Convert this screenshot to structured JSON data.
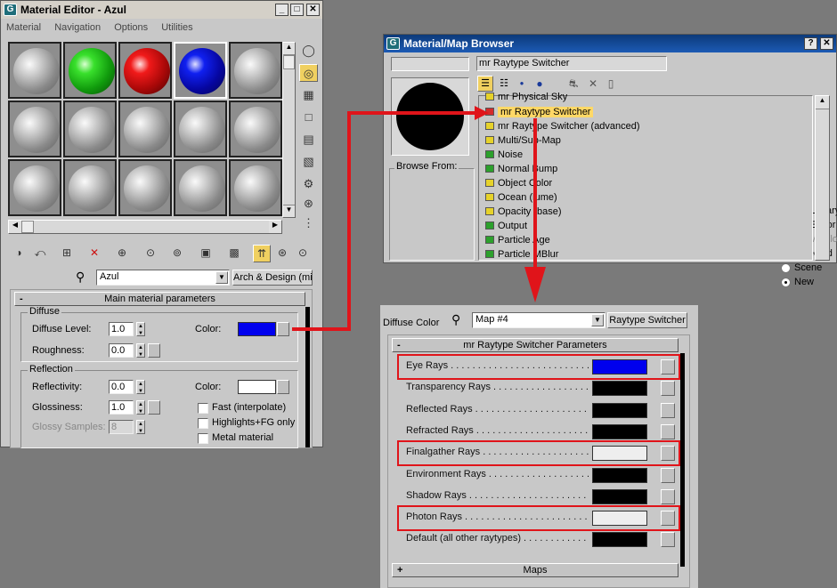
{
  "material_editor": {
    "title": "Material Editor - Azul",
    "menu": [
      "Material",
      "Navigation",
      "Options",
      "Utilities"
    ],
    "material_name": "Azul",
    "material_type": "Arch & Design (mi)",
    "rollout_title": "Main material parameters",
    "diffuse": {
      "group_label": "Diffuse",
      "level_label": "Diffuse Level:",
      "level_value": "1.0",
      "roughness_label": "Roughness:",
      "roughness_value": "0.0",
      "color_label": "Color:",
      "color": "#0000ee"
    },
    "reflection": {
      "group_label": "Reflection",
      "reflectivity_label": "Reflectivity:",
      "reflectivity_value": "0.0",
      "glossiness_label": "Glossiness:",
      "glossiness_value": "1.0",
      "glossy_samples_label": "Glossy Samples:",
      "glossy_samples_value": "8",
      "color_label": "Color:",
      "color": "#ffffff",
      "fast_label": "Fast (interpolate)",
      "highlights_label": "Highlights+FG only",
      "metal_label": "Metal material"
    }
  },
  "browser": {
    "title": "Material/Map Browser",
    "search_value": "mr Raytype Switcher",
    "browse_from_label": "Browse From:",
    "browse_options": [
      {
        "label": "Mtl Library",
        "enabled": true,
        "selected": false
      },
      {
        "label": "Mtl Editor",
        "enabled": true,
        "selected": false
      },
      {
        "label": "Active Slot",
        "enabled": false,
        "selected": false
      },
      {
        "label": "Selected",
        "enabled": true,
        "selected": false
      },
      {
        "label": "Scene",
        "enabled": true,
        "selected": false
      },
      {
        "label": "New",
        "enabled": true,
        "selected": true
      }
    ],
    "list_items": [
      {
        "label": "mr Physical Sky",
        "icon": "yellow"
      },
      {
        "label": "mr Raytype Switcher",
        "icon": "red",
        "highlighted": true
      },
      {
        "label": "mr Raytype Switcher (advanced)",
        "icon": "yellow"
      },
      {
        "label": "Multi/Sub-Map",
        "icon": "yellow"
      },
      {
        "label": "Noise",
        "icon": "green"
      },
      {
        "label": "Normal Bump",
        "icon": "green"
      },
      {
        "label": "Object Color",
        "icon": "yellow"
      },
      {
        "label": "Ocean (lume)",
        "icon": "yellow"
      },
      {
        "label": "Opacity (base)",
        "icon": "yellow"
      },
      {
        "label": "Output",
        "icon": "green"
      },
      {
        "label": "Particle Age",
        "icon": "green"
      },
      {
        "label": "Particle MBlur",
        "icon": "green"
      }
    ]
  },
  "map_panel": {
    "diffuse_color_label": "Diffuse Color",
    "map_name": "Map #4",
    "map_type": "Raytype Switcher",
    "rollout_title": "mr Raytype Switcher Parameters",
    "maps_rollout": "Maps",
    "rays": [
      {
        "label": "Eye Rays",
        "color": "#0000ee",
        "boxed": true
      },
      {
        "label": "Transparency Rays",
        "color": "#000000",
        "boxed": false
      },
      {
        "label": "Reflected Rays",
        "color": "#000000",
        "boxed": false
      },
      {
        "label": "Refracted Rays",
        "color": "#000000",
        "boxed": false
      },
      {
        "label": "Finalgather Rays",
        "color": "#eeeeee",
        "boxed": true
      },
      {
        "label": "Environment Rays",
        "color": "#000000",
        "boxed": false
      },
      {
        "label": "Shadow Rays",
        "color": "#000000",
        "boxed": false
      },
      {
        "label": "Photon Rays",
        "color": "#eeeeee",
        "boxed": true
      },
      {
        "label": "Default (all other raytypes)",
        "color": "#000000",
        "boxed": false
      }
    ]
  },
  "colors": {
    "annotation_red": "#e0141a",
    "title_blue": "#1c4f9c"
  }
}
